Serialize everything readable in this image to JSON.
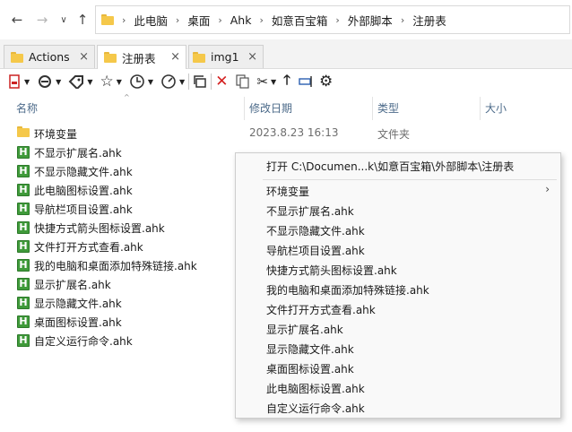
{
  "nav": {
    "back_icon": "arrow-left",
    "forward_icon": "arrow-right",
    "dropdown_icon": "chevron-down",
    "up_icon": "arrow-up"
  },
  "breadcrumb": [
    "此电脑",
    "桌面",
    "Ahk",
    "如意百宝箱",
    "外部脚本",
    "注册表"
  ],
  "tabs": [
    {
      "label": "Actions",
      "close": "×"
    },
    {
      "label": "注册表",
      "close": "×"
    },
    {
      "label": "img1",
      "close": "×"
    }
  ],
  "columns": {
    "name": "名称",
    "date": "修改日期",
    "type": "类型",
    "size": "大小"
  },
  "files": [
    {
      "name": "环境变量",
      "date": "2023.8.23 16:13",
      "type": "文件夹",
      "kind": "folder"
    },
    {
      "name": "不显示扩展名.ahk",
      "date": "",
      "type": "",
      "kind": "ahk"
    },
    {
      "name": "不显示隐藏文件.ahk",
      "date": "",
      "type": "",
      "kind": "ahk"
    },
    {
      "name": "此电脑图标设置.ahk",
      "date": "",
      "type": "",
      "kind": "ahk"
    },
    {
      "name": "导航栏项目设置.ahk",
      "date": "",
      "type": "",
      "kind": "ahk"
    },
    {
      "name": "快捷方式箭头图标设置.ahk",
      "date": "",
      "type": "",
      "kind": "ahk"
    },
    {
      "name": "文件打开方式查看.ahk",
      "date": "",
      "type": "",
      "kind": "ahk"
    },
    {
      "name": "我的电脑和桌面添加特殊链接.ahk",
      "date": "",
      "type": "",
      "kind": "ahk"
    },
    {
      "name": "显示扩展名.ahk",
      "date": "",
      "type": "",
      "kind": "ahk"
    },
    {
      "name": "显示隐藏文件.ahk",
      "date": "",
      "type": "",
      "kind": "ahk"
    },
    {
      "name": "桌面图标设置.ahk",
      "date": "",
      "type": "",
      "kind": "ahk"
    },
    {
      "name": "自定义运行命令.ahk",
      "date": "",
      "type": "",
      "kind": "ahk"
    }
  ],
  "context_menu": {
    "open": "打开 C:\\Documen...k\\如意百宝箱\\外部脚本\\注册表",
    "submenu_arrow": "›",
    "items": [
      "环境变量",
      "不显示扩展名.ahk",
      "不显示隐藏文件.ahk",
      "导航栏项目设置.ahk",
      "快捷方式箭头图标设置.ahk",
      "我的电脑和桌面添加特殊链接.ahk",
      "文件打开方式查看.ahk",
      "显示扩展名.ahk",
      "显示隐藏文件.ahk",
      "桌面图标设置.ahk",
      "此电脑图标设置.ahk",
      "自定义运行命令.ahk"
    ]
  },
  "colors": {
    "folder": "#f5c84a",
    "ahk": "#3f9a3a",
    "header_text": "#4d6b8a",
    "delete": "#d42020"
  }
}
